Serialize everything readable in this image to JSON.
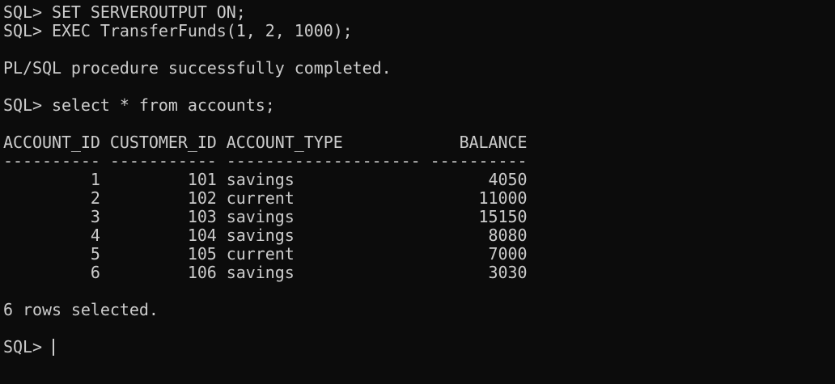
{
  "terminal": {
    "lines": [
      "SQL> SET SERVEROUTPUT ON;",
      "SQL> EXEC TransferFunds(1, 2, 1000);",
      "",
      "PL/SQL procedure successfully completed.",
      "",
      "SQL> select * from accounts;",
      "",
      "ACCOUNT_ID CUSTOMER_ID ACCOUNT_TYPE            BALANCE",
      "---------- ----------- -------------------- ----------",
      "         1         101 savings                    4050",
      "         2         102 current                   11000",
      "         3         103 savings                   15150",
      "         4         104 savings                    8080",
      "         5         105 current                    7000",
      "         6         106 savings                    3030",
      "",
      "6 rows selected.",
      "",
      "SQL> "
    ]
  }
}
